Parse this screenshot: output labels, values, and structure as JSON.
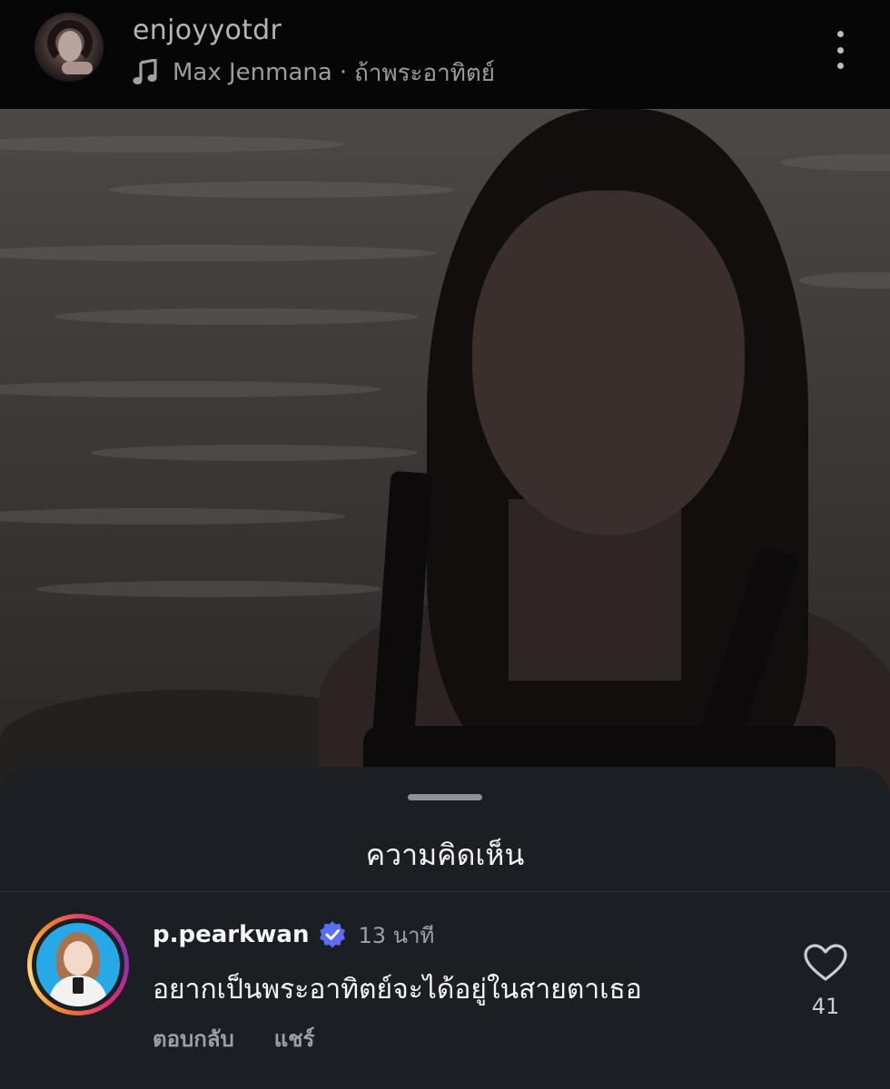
{
  "header": {
    "username": "enjoyyotdr",
    "music": {
      "icon": "music-note-icon",
      "artist": "Max Jenmana",
      "separator": "·",
      "song": "ถ้าพระอาทิตย์"
    },
    "menu_icon": "more-vertical-icon"
  },
  "comments_sheet": {
    "title": "ความคิดเห็น",
    "comments": [
      {
        "username": "p.pearkwan",
        "verified": true,
        "time": "13 นาที",
        "text": "อยากเป็นพระอาทิตย์จะได้อยู่ในสายตาเธอ",
        "reply_label": "ตอบกลับ",
        "share_label": "แชร์",
        "like_count": "41",
        "like_icon": "heart-outline-icon"
      }
    ]
  },
  "colors": {
    "sheet_background": "#1b1f24",
    "verified_badge": "#5b6cf5",
    "story_ring": [
      "#f58529",
      "#dd2a7b",
      "#8134af"
    ]
  }
}
